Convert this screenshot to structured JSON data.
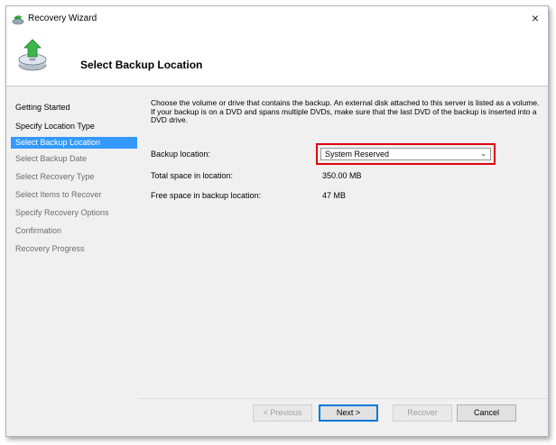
{
  "window": {
    "title": "Recovery Wizard",
    "close_glyph": "×"
  },
  "header": {
    "title": "Select Backup Location",
    "icon": "recovery-wizard-icon"
  },
  "nav": {
    "items": [
      {
        "label": "Getting Started",
        "state": "done"
      },
      {
        "label": "Specify Location Type",
        "state": "done"
      },
      {
        "label": "Select Backup Location",
        "state": "active"
      },
      {
        "label": "Select Backup Date",
        "state": "todo"
      },
      {
        "label": "Select Recovery Type",
        "state": "todo"
      },
      {
        "label": "Select Items to Recover",
        "state": "todo"
      },
      {
        "label": "Specify Recovery Options",
        "state": "todo"
      },
      {
        "label": "Confirmation",
        "state": "todo"
      },
      {
        "label": "Recovery Progress",
        "state": "todo"
      }
    ]
  },
  "content": {
    "instructions": "Choose the volume or drive that contains the backup. An external disk attached to this server is listed as a volume. If your backup is on a DVD and spans multiple DVDs, make sure that the last DVD of the backup is inserted into a DVD drive.",
    "backup_location_label": "Backup location:",
    "backup_location_value": "System Reserved",
    "total_space_label": "Total space in location:",
    "total_space_value": "350.00 MB",
    "free_space_label": "Free space in backup location:",
    "free_space_value": "47 MB"
  },
  "buttons": {
    "previous": "< Previous",
    "next": "Next >",
    "recover": "Recover",
    "cancel": "Cancel"
  },
  "colors": {
    "nav_active": "#3399ff",
    "highlight_frame": "#e0000d",
    "primary_button_border": "#0078d7"
  }
}
